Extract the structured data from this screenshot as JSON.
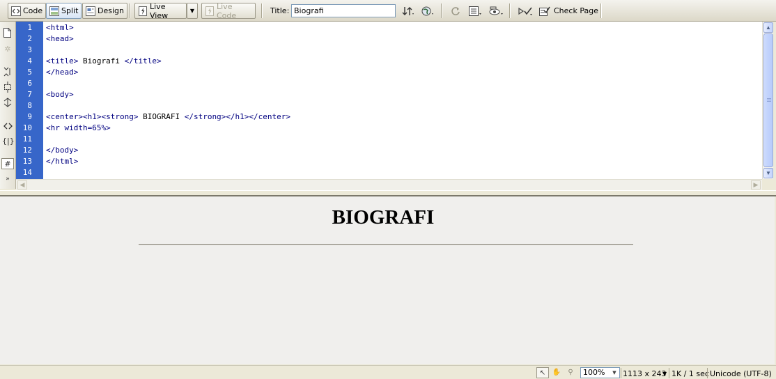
{
  "toolbar": {
    "code_label": "Code",
    "split_label": "Split",
    "design_label": "Design",
    "live_view_label": "Live View",
    "live_code_label": "Live Code",
    "title_label": "Title:",
    "title_value": "Biografi",
    "check_page_label": "Check Page",
    "active_view": "Split"
  },
  "code_view": {
    "line_numbers": [
      "1",
      "2",
      "3",
      "4",
      "5",
      "6",
      "7",
      "8",
      "9",
      "10",
      "11",
      "12",
      "13",
      "14"
    ],
    "lines": [
      "<html>",
      "<head>",
      "",
      "<title> Biografi </title>",
      "</head>",
      "",
      "<body>",
      "",
      "<center><h1><strong> BIOGRAFI </strong></h1></center>",
      "<hr width=65%>",
      "",
      "</body>",
      "</html>",
      ""
    ],
    "gutter_color": "#3766c9",
    "tag_color": "#000080"
  },
  "design_view": {
    "heading": "BIOGRAFI"
  },
  "status_bar": {
    "zoom": "100%",
    "window_size": "1113 x 243",
    "file_info": "1K / 1 sec",
    "encoding": "Unicode (UTF-8)"
  }
}
